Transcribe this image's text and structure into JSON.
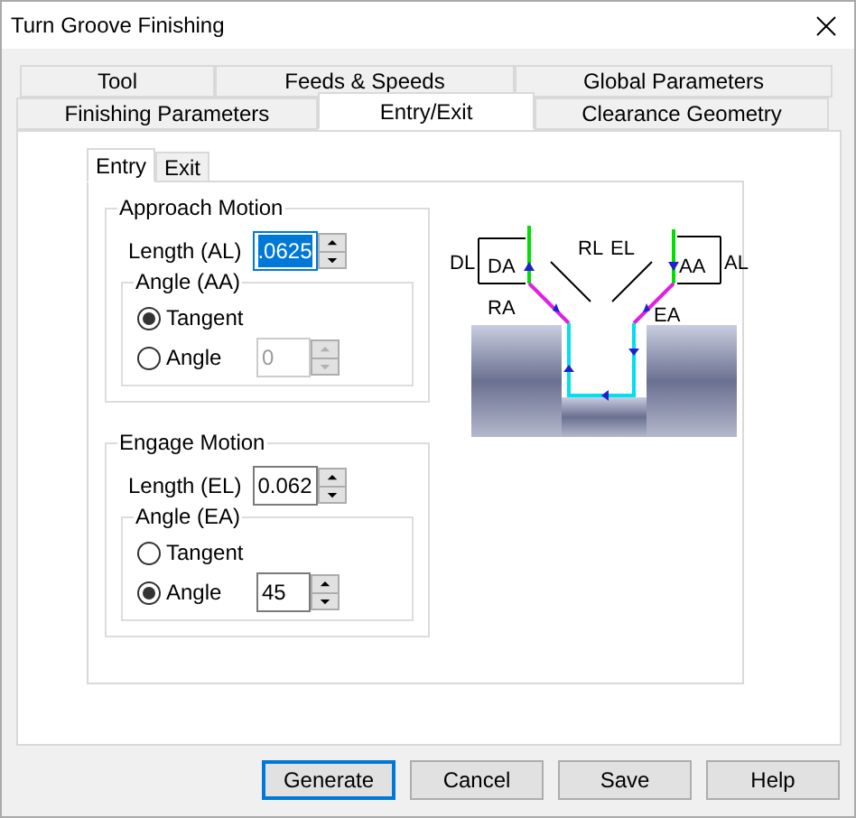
{
  "window": {
    "title": "Turn Groove Finishing"
  },
  "tab_rows": [
    [
      {
        "label": "Tool",
        "selected": false
      },
      {
        "label": "Feeds & Speeds",
        "selected": false
      },
      {
        "label": "Global Parameters",
        "selected": false
      }
    ],
    [
      {
        "label": "Finishing Parameters",
        "selected": false
      },
      {
        "label": "Entry/Exit",
        "selected": true
      },
      {
        "label": "Clearance Geometry",
        "selected": false
      }
    ]
  ],
  "subtabs": [
    {
      "label": "Entry",
      "selected": true
    },
    {
      "label": "Exit",
      "selected": false
    }
  ],
  "groups": [
    {
      "title": "Approach Motion",
      "length": {
        "label": "Length (AL)",
        "value": ".0625",
        "highlighted": true
      },
      "angle": {
        "title": "Angle (AA)",
        "options": [
          {
            "label": "Tangent",
            "selected": true
          },
          {
            "label": "Angle",
            "selected": false
          }
        ],
        "value": "0",
        "disabled": true
      }
    },
    {
      "title": "Engage Motion",
      "length": {
        "label": "Length (EL)",
        "value": "0.062",
        "highlighted": false
      },
      "angle": {
        "title": "Angle (EA)",
        "options": [
          {
            "label": "Tangent",
            "selected": false
          },
          {
            "label": "Angle",
            "selected": true
          }
        ],
        "value": "45",
        "disabled": false
      }
    }
  ],
  "diagram": {
    "labels": [
      "DL",
      "DA",
      "RL",
      "RA",
      "EL",
      "AA",
      "AL",
      "EA"
    ]
  },
  "buttons": [
    {
      "label": "Generate",
      "default": true
    },
    {
      "label": "Cancel",
      "default": false
    },
    {
      "label": "Save",
      "default": false
    },
    {
      "label": "Help",
      "default": false
    }
  ]
}
